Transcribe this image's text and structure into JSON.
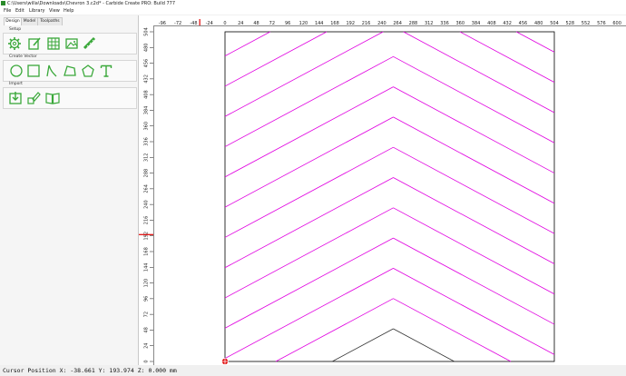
{
  "window": {
    "title": "C:\\Users\\willa\\Downloads\\Chevron 3.c2d* - Carbide Create PRO: Build 777"
  },
  "menu": [
    "File",
    "Edit",
    "Library",
    "View",
    "Help"
  ],
  "tabs": [
    "Design",
    "Model",
    "Toolpaths"
  ],
  "sections": {
    "setup": "Setup",
    "create_vector": "Create Vector",
    "import": "Import"
  },
  "tools": {
    "setup": [
      "gear-icon",
      "edit-page-icon",
      "grid-icon",
      "image-icon",
      "ruler-icon"
    ],
    "create_vector": [
      "circle-icon",
      "rectangle-icon",
      "curve-icon",
      "polygon-icon",
      "pentagon-icon",
      "text-icon"
    ],
    "import": [
      "import-icon",
      "trace-icon",
      "library-book-icon"
    ]
  },
  "rulers": {
    "top_ticks": [
      "-96",
      "-72",
      "-48",
      "-24",
      "0",
      "24",
      "48",
      "72",
      "96",
      "120",
      "144",
      "168",
      "192",
      "216",
      "240",
      "264",
      "288",
      "312",
      "336",
      "360",
      "384",
      "408",
      "432",
      "456",
      "480",
      "504",
      "528",
      "552",
      "576",
      "600"
    ],
    "left_ticks": [
      "504",
      "480",
      "456",
      "432",
      "408",
      "384",
      "360",
      "336",
      "312",
      "288",
      "264",
      "240",
      "216",
      "192",
      "168",
      "144",
      "120",
      "96",
      "72",
      "48",
      "24",
      "0"
    ]
  },
  "colors": {
    "chevron_lines": "#e000e0",
    "stock_outline": "#000000",
    "tool_icons": "#3aa83a",
    "cursor_marker": "#e00000"
  },
  "status": {
    "cursor": "Cursor Position X: -38.661 Y: 193.974 Z: 0.000 mm"
  }
}
